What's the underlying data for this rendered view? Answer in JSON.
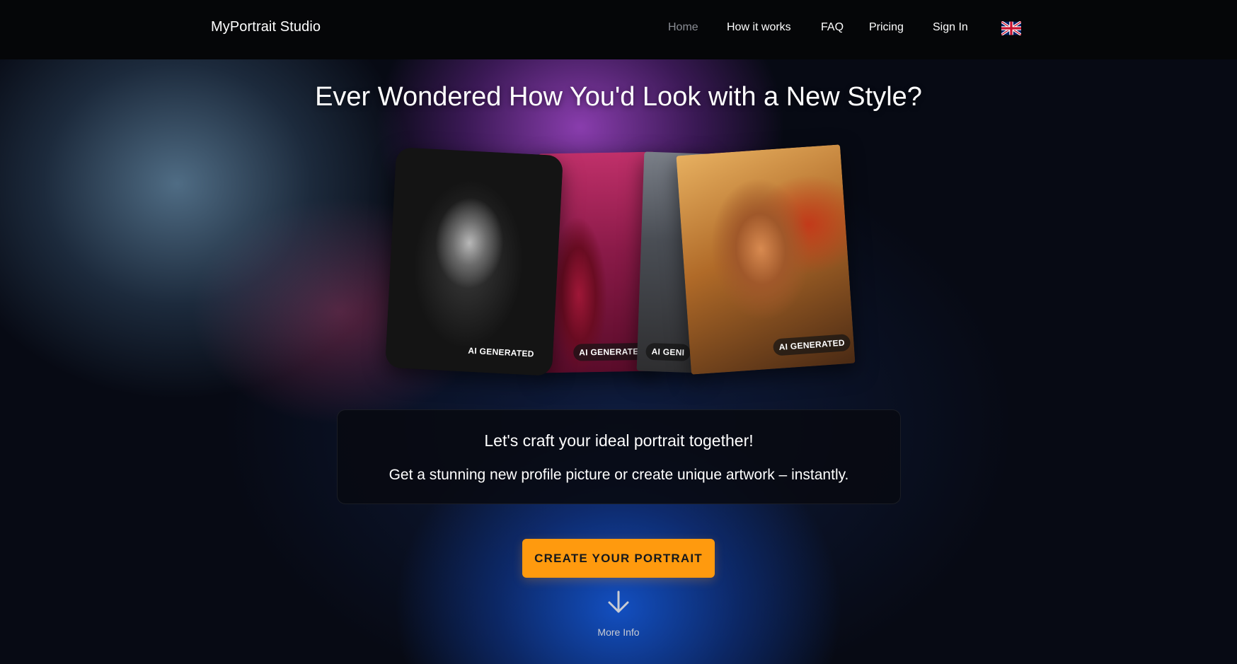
{
  "nav": {
    "brand": "MyPortrait Studio",
    "links": [
      {
        "label": "Home",
        "active": true
      },
      {
        "label": "How it works",
        "active": false
      },
      {
        "label": "FAQ",
        "active": false
      },
      {
        "label": "Pricing",
        "active": false
      },
      {
        "label": "Sign In",
        "active": false
      }
    ],
    "language_icon": "uk-flag-icon"
  },
  "hero": {
    "headline": "Ever Wondered How You'd Look with a New Style?",
    "cards": [
      {
        "badge": "AI GENERATED"
      },
      {
        "badge": "AI GENERATED"
      },
      {
        "badge": "AI GENI"
      },
      {
        "badge": "AI GENERATED"
      }
    ]
  },
  "info": {
    "line1": "Let's craft your ideal portrait together!",
    "line2": "Get a stunning new profile picture or create unique artwork – instantly."
  },
  "cta": {
    "label": "CREATE YOUR PORTRAIT",
    "color": "#ff9a0e"
  },
  "more": {
    "label": "More Info",
    "icon": "arrow-down-icon"
  }
}
